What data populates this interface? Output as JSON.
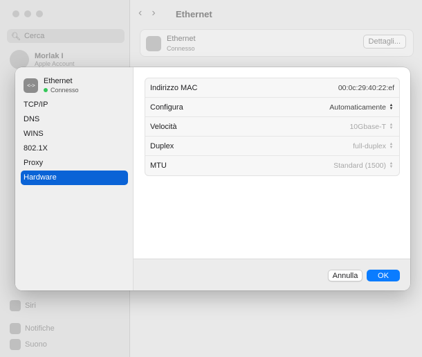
{
  "background": {
    "search_placeholder": "Cerca",
    "account_name": "Morlak I",
    "account_sub": "Apple Account",
    "sidebar_items": [
      "Siri",
      "Notifiche",
      "Suono"
    ],
    "page_title": "Ethernet",
    "card_title": "Ethernet",
    "card_status": "Connesso",
    "details_button": "Dettagli..."
  },
  "dialog": {
    "header": {
      "title": "Ethernet",
      "status": "Connesso",
      "status_color": "#34c759"
    },
    "menu": [
      {
        "label": "TCP/IP"
      },
      {
        "label": "DNS"
      },
      {
        "label": "WINS"
      },
      {
        "label": "802.1X"
      },
      {
        "label": "Proxy"
      },
      {
        "label": "Hardware",
        "active": true
      }
    ],
    "rows": [
      {
        "label": "Indirizzo MAC",
        "value": "00:0c:29:40:22:ef"
      },
      {
        "label": "Configura",
        "value": "Automaticamente"
      },
      {
        "label": "Velocità",
        "value": "10Gbase-T"
      },
      {
        "label": "Duplex",
        "value": "full-duplex"
      },
      {
        "label": "MTU",
        "value": "Standard (1500)"
      }
    ],
    "buttons": {
      "cancel": "Annulla",
      "ok": "OK"
    },
    "accent_color": "#0a63d6"
  }
}
